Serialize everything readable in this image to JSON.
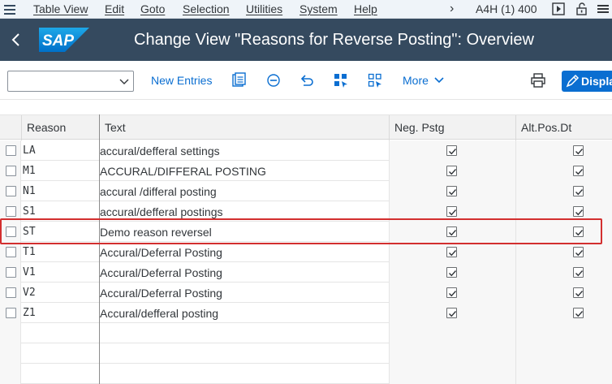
{
  "menu": {
    "items": [
      "Table View",
      "Edit",
      "Goto",
      "Selection",
      "Utilities",
      "System",
      "Help"
    ],
    "system_info": "A4H (1) 400"
  },
  "shell": {
    "logo_text": "SAP",
    "title": "Change View \"Reasons for Reverse Posting\": Overview"
  },
  "toolbar": {
    "combo_value": "",
    "new_entries": "New Entries",
    "more": "More",
    "display": "Display"
  },
  "table": {
    "columns": [
      "Reason",
      "Text",
      "Neg. Pstg",
      "Alt.Pos.Dt"
    ],
    "rows": [
      {
        "reason": "LA",
        "text": "accural/defferal settings",
        "neg_pstg": true,
        "alt_pos_dt": true
      },
      {
        "reason": "M1",
        "text": "ACCURAL/DIFFERAL POSTING",
        "neg_pstg": true,
        "alt_pos_dt": true
      },
      {
        "reason": "N1",
        "text": "accural /differal posting",
        "neg_pstg": true,
        "alt_pos_dt": true
      },
      {
        "reason": "S1",
        "text": "accural/defferal postings",
        "neg_pstg": true,
        "alt_pos_dt": true
      },
      {
        "reason": "ST",
        "text": "Demo reason reversel",
        "neg_pstg": true,
        "alt_pos_dt": true
      },
      {
        "reason": "T1",
        "text": "Accural/Deferral Posting",
        "neg_pstg": true,
        "alt_pos_dt": true
      },
      {
        "reason": "V1",
        "text": "Accural/Deferral Posting",
        "neg_pstg": true,
        "alt_pos_dt": true
      },
      {
        "reason": "V2",
        "text": "Accural/Deferral Posting",
        "neg_pstg": true,
        "alt_pos_dt": true
      },
      {
        "reason": "Z1",
        "text": "Accural/defferal posting",
        "neg_pstg": true,
        "alt_pos_dt": true
      }
    ],
    "highlighted_row": "ST"
  },
  "colors": {
    "shell_bg": "#354a5f",
    "accent": "#0a6ed1",
    "highlight_border": "#d32f2f"
  },
  "icons": {
    "menu": "hamburger-icon",
    "back": "back-arrow-icon",
    "play": "execute-icon",
    "lock": "unlock-icon",
    "more_menu": "overflow-icon",
    "details": "details-icon",
    "delete": "remove-circle-icon",
    "undo": "undo-icon",
    "select_all": "select-all-icon",
    "deselect_all": "deselect-all-icon",
    "print": "print-icon",
    "display": "display-icon"
  }
}
